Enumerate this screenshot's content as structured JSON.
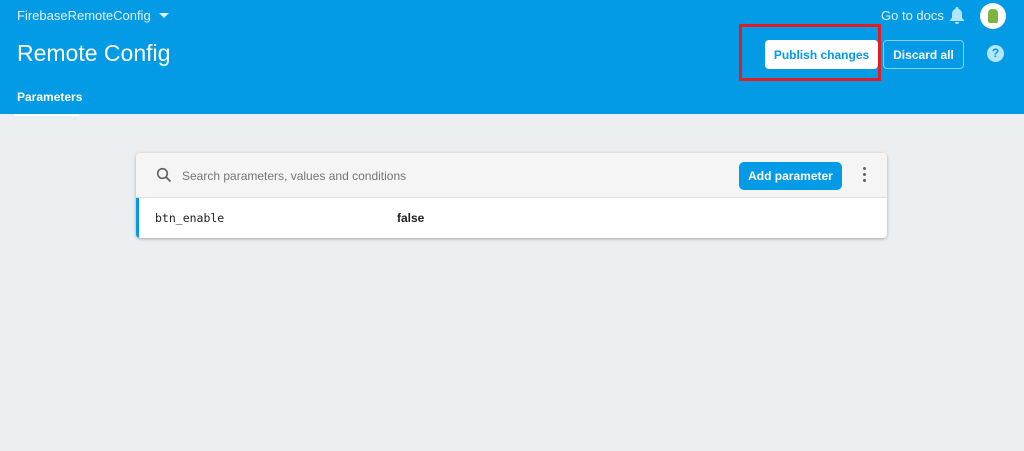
{
  "header": {
    "project": "FirebaseRemoteConfig",
    "title": "Remote Config",
    "go_to_docs": "Go to docs",
    "publish": "Publish changes",
    "discard": "Discard all",
    "help": "?",
    "tabs": [
      {
        "label": "Parameters"
      }
    ]
  },
  "toolbar": {
    "search_placeholder": "Search parameters, values and conditions",
    "add": "Add parameter"
  },
  "parameters": [
    {
      "key": "btn_enable",
      "value": "false"
    }
  ],
  "colors": {
    "brand": "#039be5",
    "highlight": "#e31b23"
  }
}
